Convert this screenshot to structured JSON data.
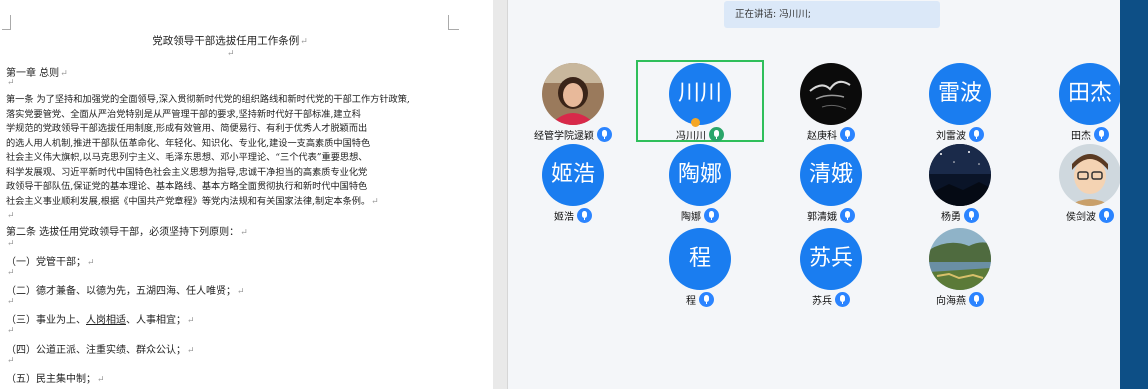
{
  "document": {
    "title": "党政领导干部选拔任用工作条例",
    "chapter": "第一章 总则",
    "article1_lines": [
      "第一条 为了坚持和加强党的全面领导,深入贯彻新时代党的组织路线和新时代党的干部工作方针政策,",
      "落实党要管党、全面从严治党特别是从严管理干部的要求,坚持新时代好干部标准,建立科",
      "学规范的党政领导干部选拔任用制度,形成有效管用、简便易行、有利于优秀人才脱颖而出",
      "的选人用人机制,推进干部队伍革命化、年轻化、知识化、专业化,建设一支高素质中国特色",
      "社会主义伟大旗帜,以马克思列宁主义、毛泽东思想、邓小平理论、“三个代表”重要思想、",
      "科学发展观、习近平新时代中国特色社会主义思想为指导,忠诚干净担当的高素质专业化党",
      "政领导干部队伍,保证党的基本理论、基本路线、基本方略全面贯彻执行和新时代中国特色",
      "社会主义事业顺利发展,根据《中国共产党章程》等党内法规和有关国家法律,制定本条例。"
    ],
    "article2": "第二条 选拔任用党政领导干部，必须坚持下列原则：",
    "principles": [
      "（一）党管干部；",
      "（二）德才兼备、以德为先，五湖四海、任人唯贤；",
      "（三）事业为上、",
      "（四）公道正派、注重实绩、群众公认；",
      "（五）民主集中制；"
    ],
    "principle3_underlined": "人岗相适",
    "principle3_tail": "、人事相宜；"
  },
  "meeting": {
    "speaking_text": "正在讲话: 冯川川;",
    "participants": [
      {
        "name": "经管学院逯颖",
        "avatar_text": "",
        "avatar_type": "photo-woman"
      },
      {
        "name": "冯川川",
        "avatar_text": "川川",
        "avatar_type": "text",
        "active": true
      },
      {
        "name": "赵庚科",
        "avatar_text": "",
        "avatar_type": "photo-dark"
      },
      {
        "name": "刘雷波",
        "avatar_text": "雷波",
        "avatar_type": "text"
      },
      {
        "name": "田杰",
        "avatar_text": "田杰",
        "avatar_type": "text"
      },
      {
        "name": "姬浩",
        "avatar_text": "姬浩",
        "avatar_type": "text"
      },
      {
        "name": "陶娜",
        "avatar_text": "陶娜",
        "avatar_type": "text"
      },
      {
        "name": "郭清娥",
        "avatar_text": "清娥",
        "avatar_type": "text"
      },
      {
        "name": "杨勇",
        "avatar_text": "",
        "avatar_type": "photo-night"
      },
      {
        "name": "侯剑波",
        "avatar_text": "",
        "avatar_type": "photo-cartoon"
      },
      {
        "name": "程",
        "avatar_text": "程",
        "avatar_type": "text"
      },
      {
        "name": "苏兵",
        "avatar_text": "苏兵",
        "avatar_type": "text"
      },
      {
        "name": "向海燕",
        "avatar_text": "",
        "avatar_type": "photo-landscape"
      }
    ]
  },
  "colors": {
    "avatar_blue": "#1a7df0",
    "active_border": "#2fbf5b",
    "speaking_bg": "#dbe8f8"
  }
}
